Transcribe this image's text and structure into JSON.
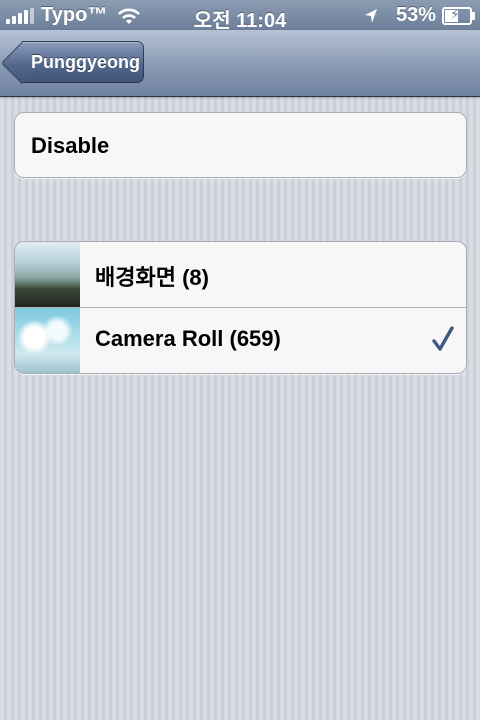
{
  "status_bar": {
    "carrier": "Typo™",
    "time": "오전 11:04",
    "battery": "53%",
    "battery_level": 0.53
  },
  "nav_bar": {
    "back_label": "Punggyeong"
  },
  "settings": {
    "disable_label": "Disable"
  },
  "albums": [
    {
      "label": "배경화면 (8)",
      "selected": false
    },
    {
      "label": "Camera Roll (659)",
      "selected": true
    }
  ],
  "colors": {
    "check": "#3e5886",
    "nav_bar": "#8899b3",
    "background": "#d2d6de"
  },
  "icons": [
    "signal-icon",
    "wifi-icon",
    "location-arrow-icon",
    "battery-charging-icon",
    "back-arrow-icon",
    "checkmark-icon"
  ]
}
